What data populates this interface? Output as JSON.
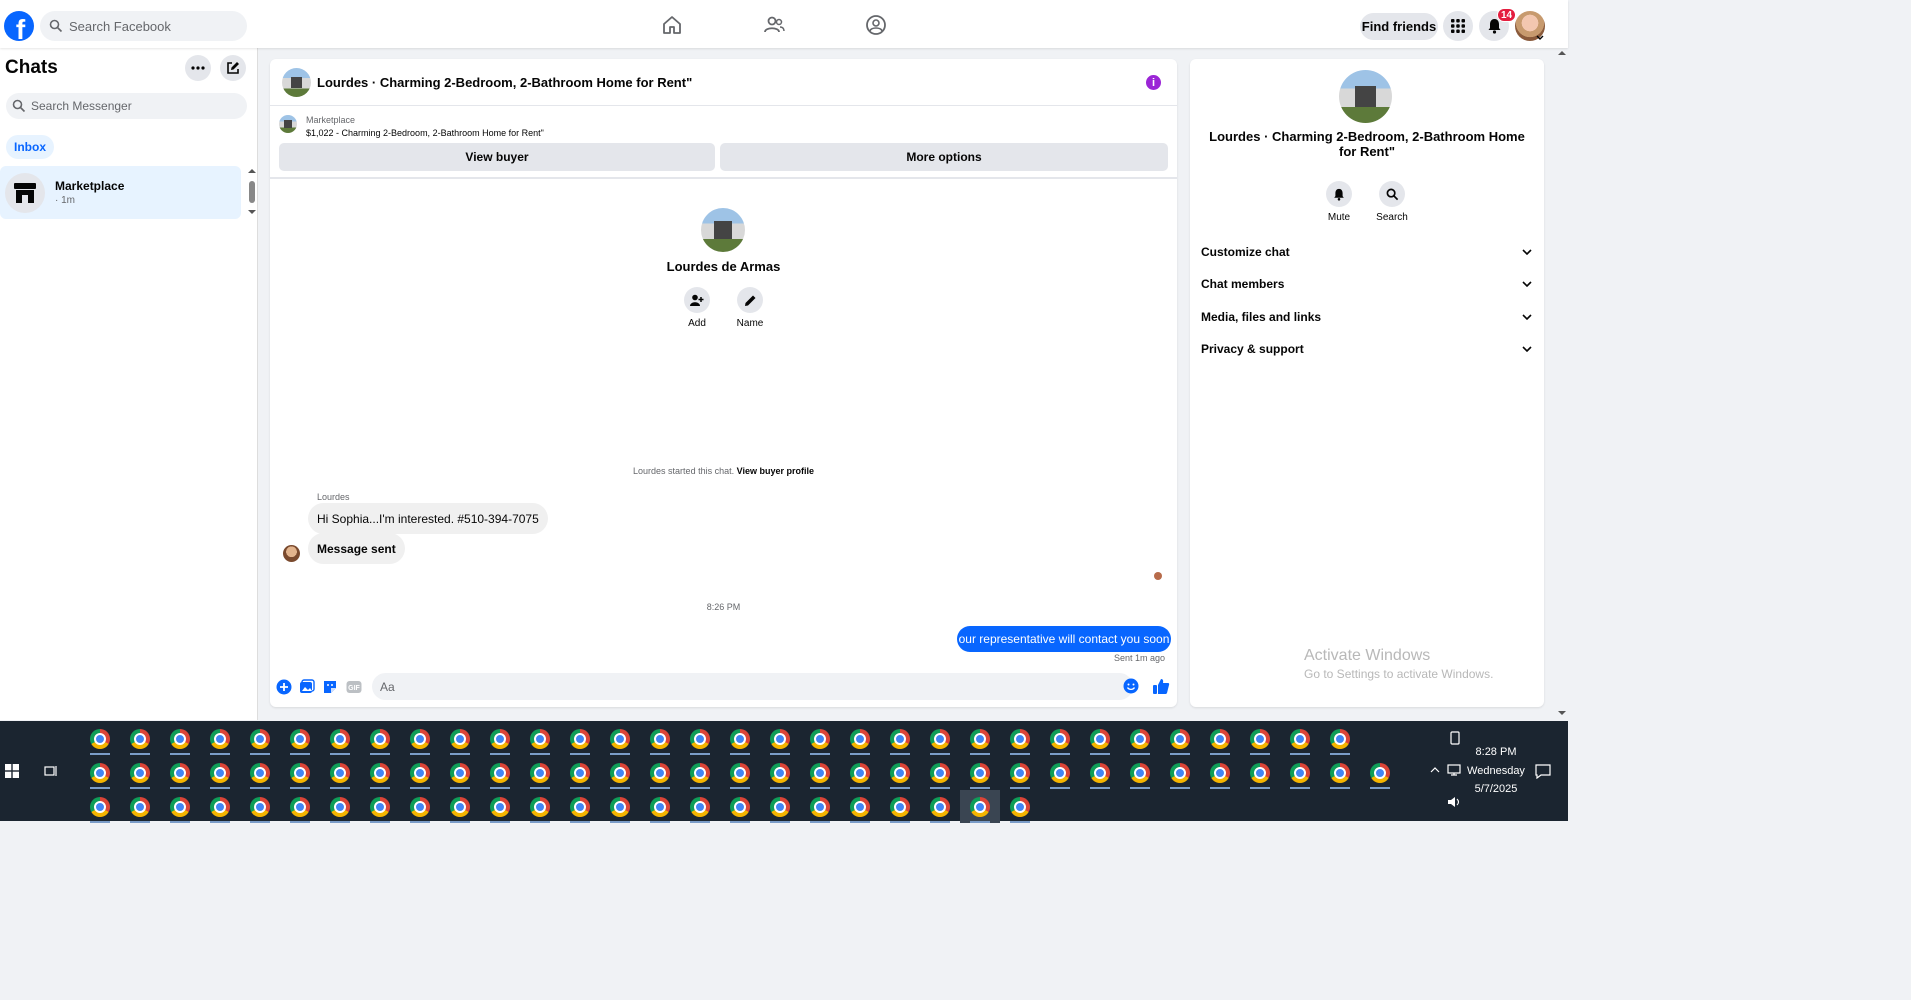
{
  "topbar": {
    "search_placeholder": "Search Facebook",
    "find_friends": "Find friends",
    "notification_count": "14",
    "logo_letter": "f"
  },
  "sidebar": {
    "title": "Chats",
    "search_placeholder": "Search Messenger",
    "filter": "Inbox",
    "conversations": [
      {
        "name": "Marketplace",
        "time": "· 1m"
      }
    ]
  },
  "chat": {
    "header_title": "Lourdes · Charming 2-Bedroom, 2-Bathroom Home for Rent\"",
    "listing_source": "Marketplace",
    "listing_price_title": "$1,022 - Charming 2-Bedroom, 2-Bathroom Home for Rent\"",
    "view_buyer": "View buyer",
    "more_options": "More options",
    "contact_name": "Lourdes de Armas",
    "actions": [
      {
        "label": "Add",
        "icon": "add-person-icon"
      },
      {
        "label": "Name",
        "icon": "pencil-icon"
      }
    ],
    "started_text": "Lourdes started this chat.",
    "view_buyer_profile": "View buyer profile",
    "sender_name": "Lourdes",
    "incoming": [
      "Hi Sophia...I'm interested.  #510-394-7075",
      "Message sent"
    ],
    "timestamp": "8:26 PM",
    "outgoing": "our representative will contact you soon",
    "sent_status": "Sent 1m ago",
    "input_placeholder": "Aa"
  },
  "details": {
    "title": "Lourdes · Charming 2-Bedroom, 2-Bathroom Home for Rent\"",
    "actions": [
      {
        "label": "Mute",
        "icon": "bell-icon"
      },
      {
        "label": "Search",
        "icon": "search-icon"
      }
    ],
    "sections": [
      "Customize chat",
      "Chat members",
      "Media, files and links",
      "Privacy & support"
    ]
  },
  "watermark": {
    "line1": "Activate Windows",
    "line2": "Go to Settings to activate Windows."
  },
  "taskbar": {
    "time": "8:28 PM",
    "day": "Wednesday",
    "date": "5/7/2025"
  },
  "colors": {
    "brand": "#0866ff",
    "info": "#9b25d6",
    "badge": "#e41e3f"
  }
}
